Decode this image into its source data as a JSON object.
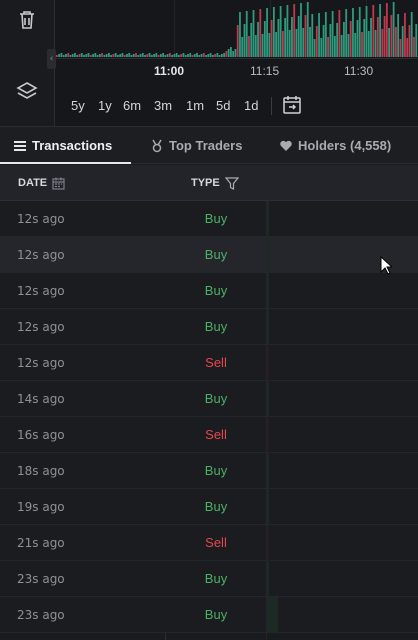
{
  "chart": {
    "time_labels": [
      "11:00",
      "11:15",
      "11:30"
    ],
    "range_buttons": [
      "5y",
      "1y",
      "6m",
      "3m",
      "1m",
      "5d",
      "1d"
    ],
    "colors": {
      "up": "#2e9b7e",
      "down": "#c0394f",
      "grid": "#22242a"
    }
  },
  "toolbar": {
    "trash_icon": "trash-icon",
    "layers_icon": "layers-icon",
    "collapse_label": "‹"
  },
  "tabs": [
    {
      "label": "Transactions",
      "icon": "list-icon",
      "active": true
    },
    {
      "label": "Top Traders",
      "icon": "medal-icon",
      "active": false
    },
    {
      "label": "Holders (4,558)",
      "icon": "heart-icon",
      "active": false
    }
  ],
  "table": {
    "headers": {
      "date": "DATE",
      "type": "TYPE"
    },
    "rows": [
      {
        "date": "12s  ago",
        "type": "Buy"
      },
      {
        "date": "12s  ago",
        "type": "Buy"
      },
      {
        "date": "12s  ago",
        "type": "Buy"
      },
      {
        "date": "12s  ago",
        "type": "Buy"
      },
      {
        "date": "12s  ago",
        "type": "Sell"
      },
      {
        "date": "14s  ago",
        "type": "Buy"
      },
      {
        "date": "16s  ago",
        "type": "Sell"
      },
      {
        "date": "18s  ago",
        "type": "Buy"
      },
      {
        "date": "19s  ago",
        "type": "Buy"
      },
      {
        "date": "21s  ago",
        "type": "Sell"
      },
      {
        "date": "23s  ago",
        "type": "Buy"
      },
      {
        "date": "23s  ago",
        "type": "Buy"
      }
    ]
  },
  "colors": {
    "buy": "#4caf65",
    "sell": "#e5484d",
    "background": "#1a1b1f"
  }
}
